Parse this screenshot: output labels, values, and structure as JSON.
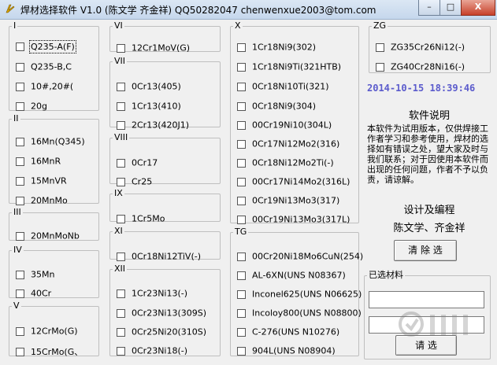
{
  "window": {
    "title": "焊材选择软件 V1.0 (陈文学  齐金祥)   QQ50282047  chenwenxue2003@tom.com",
    "minimize": "–",
    "maximize": "□",
    "close": "X"
  },
  "groups": {
    "g1": {
      "legend": "I",
      "items": [
        "Q235-A(F)",
        "Q235-B,C",
        "10#,20#(",
        "20g"
      ]
    },
    "g2": {
      "legend": "II",
      "items": [
        "16Mn(Q345)",
        "16MnR",
        "15MnVR",
        "20MnMo"
      ]
    },
    "g3": {
      "legend": "III",
      "items": [
        "20MnMoNb"
      ]
    },
    "g4": {
      "legend": "IV",
      "items": [
        "35Mn",
        "40Cr"
      ]
    },
    "g5": {
      "legend": "V",
      "items": [
        "12CrMo(G)",
        "15CrMo(G、"
      ]
    },
    "g6": {
      "legend": "VI",
      "items": [
        "12Cr1MoV(G)"
      ]
    },
    "g7": {
      "legend": "VII",
      "items": [
        "0Cr13(405)",
        "1Cr13(410)",
        "2Cr13(420J1)"
      ]
    },
    "g8": {
      "legend": "VIII",
      "items": [
        "0Cr17",
        "Cr25"
      ]
    },
    "g9": {
      "legend": "IX",
      "items": [
        "1Cr5Mo"
      ]
    },
    "g10": {
      "legend": "XI",
      "items": [
        "0Cr18Ni12TiV(-)"
      ]
    },
    "g11": {
      "legend": "XII",
      "items": [
        "1Cr23Ni13(-)",
        "0Cr23Ni13(309S)",
        "0Cr25Ni20(310S)",
        "0Cr23Ni18(-)"
      ]
    },
    "g12": {
      "legend": "X",
      "items": [
        "1Cr18Ni9(302)",
        "1Cr18Ni9Ti(321HTB)",
        "0Cr18Ni10Ti(321)",
        "0Cr18Ni9(304)",
        "00Cr19Ni10(304L)",
        "0Cr17Ni12Mo2(316)",
        "0Cr18Ni12Mo2Ti(-)",
        "00Cr17Ni14Mo2(316L)",
        "0Cr19Ni13Mo3(317)",
        "00Cr19Ni13Mo3(317L)"
      ]
    },
    "g13": {
      "legend": "TG",
      "items": [
        "00Cr20Ni18Mo6CuN(254)",
        "AL-6XN(UNS N08367)",
        "Inconel625(UNS N06625)",
        "Incoloy800(UNS N08800)",
        "C-276(UNS N10276)",
        "904L(UNS N08904)"
      ]
    },
    "g14": {
      "legend": "ZG",
      "items": [
        "ZG35Cr26Ni12(-)",
        "ZG40Cr28Ni16(-)"
      ]
    }
  },
  "clock": "2014-10-15 18:39:46",
  "about": {
    "title": "软件说明",
    "text": "本软件为试用版本，仅供焊接工作者学习和参考使用，焊材的选择如有错误之处，望大家及时与我们联系；对于因使用本软件而出现的任何问题，作者不予以负责，请谅解。",
    "design_label": "设计及编程",
    "authors": "陈文学、齐金祥"
  },
  "clear_button": "清 除 选",
  "selected": {
    "legend": "已选材料",
    "field1": "",
    "field2": ""
  },
  "select_button": "请 选",
  "watermark": "下载吧"
}
